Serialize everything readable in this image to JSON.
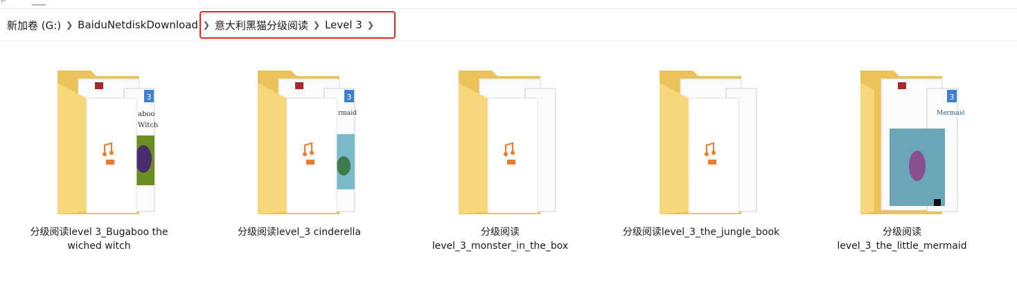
{
  "breadcrumb": {
    "items": [
      {
        "label": "新加卷 (G:)"
      },
      {
        "label": "BaiduNetdiskDownload"
      },
      {
        "label": "意大利黑猫分级阅读"
      },
      {
        "label": "Level 3"
      }
    ],
    "highlight_color": "#e5261f"
  },
  "files": [
    {
      "name": "分级阅读level 3_Bugaboo the wiched witch",
      "icon": "folder-icon",
      "badge": "3"
    },
    {
      "name": "分级阅读level_3 cinderella",
      "icon": "folder-icon",
      "badge": "3"
    },
    {
      "name": "分级阅读level_3_monster_in_the_box",
      "icon": "folder-icon",
      "badge": ""
    },
    {
      "name": "分级阅读level_3_the_jungle_book",
      "icon": "folder-icon",
      "badge": ""
    },
    {
      "name": "分级阅读level_3_the_little_mermaid",
      "icon": "folder-icon",
      "badge": "3"
    }
  ],
  "colors": {
    "folder": "#f5d57a",
    "folder_dark": "#e8c25a",
    "mp3_accent": "#f07a2a"
  }
}
